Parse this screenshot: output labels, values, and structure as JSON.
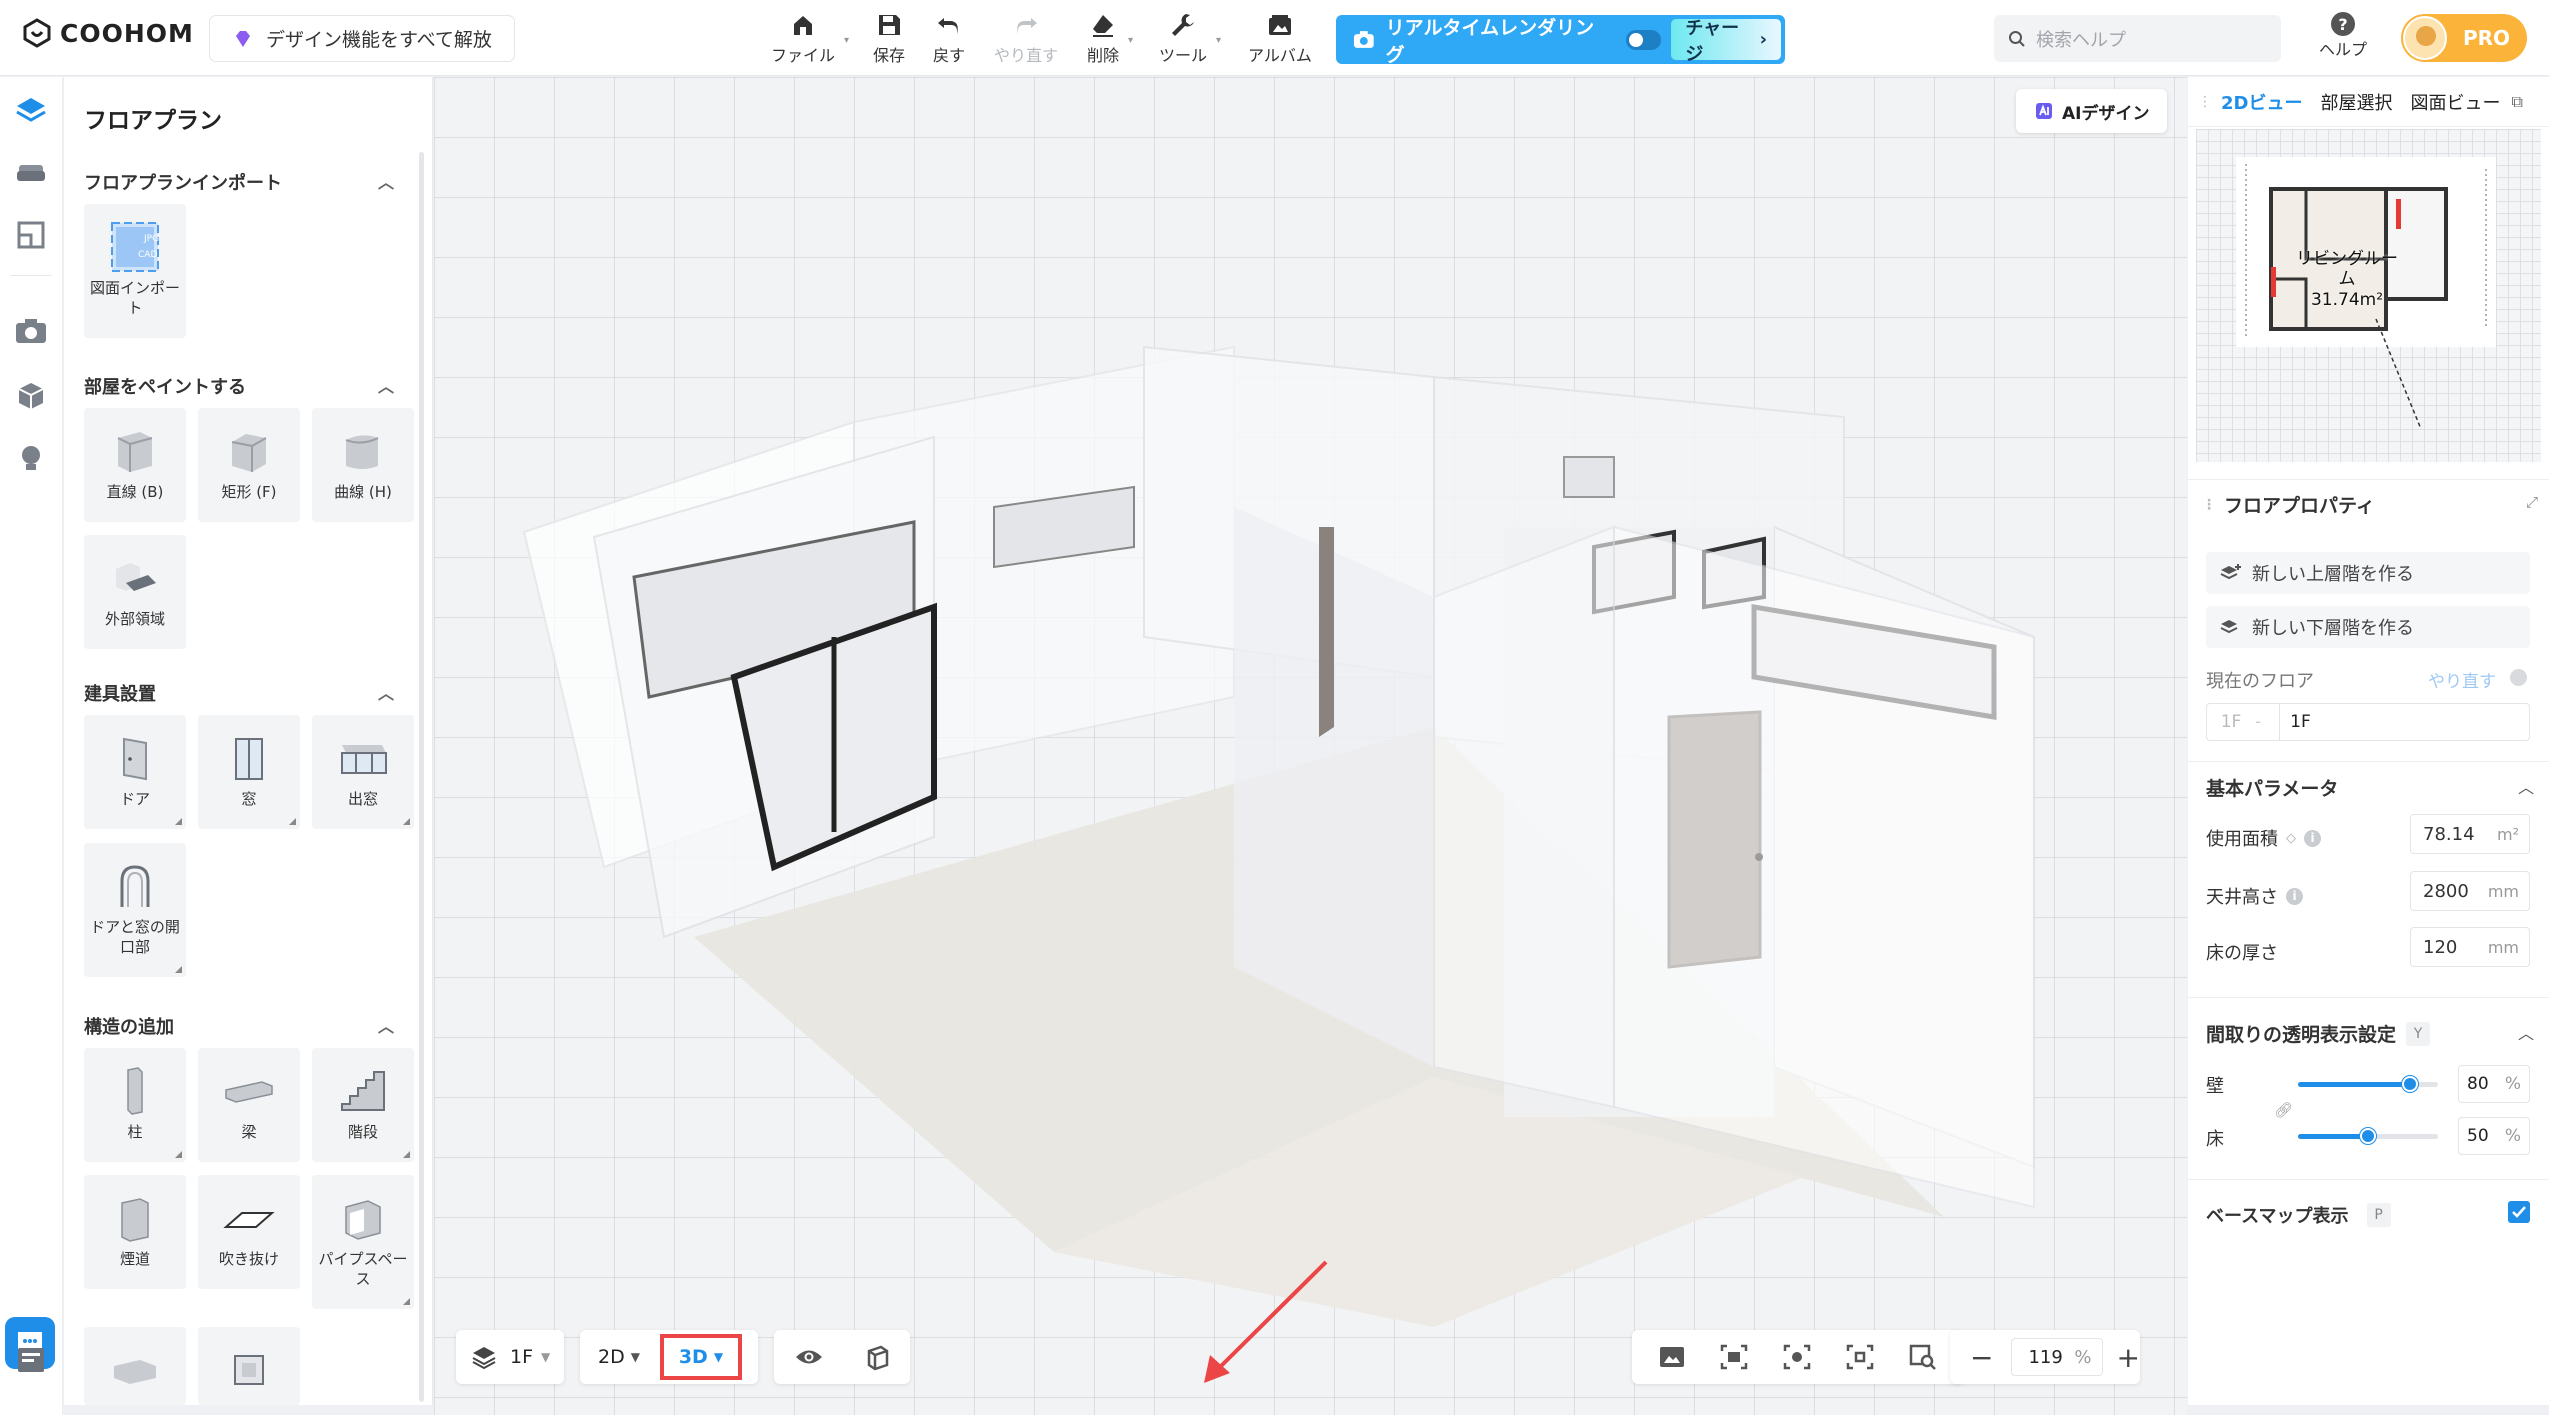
{
  "brand": {
    "name": "COOHOM",
    "unlock_label": "デザイン機能をすべて解放"
  },
  "toolbar": {
    "file": "ファイル",
    "save": "保存",
    "undo": "戻す",
    "redo": "やり直す",
    "delete": "削除",
    "tools": "ツール",
    "album": "アルバム"
  },
  "realtime": {
    "label": "リアルタイムレンダリング",
    "charge_label": "チャージ"
  },
  "search": {
    "placeholder": "検索ヘルプ"
  },
  "help": {
    "label": "ヘルプ"
  },
  "account": {
    "badge": "PRO"
  },
  "left_panel": {
    "title": "フロアプラン",
    "sections": [
      {
        "title": "フロアプランインポート",
        "items": [
          {
            "label": "図面インポート",
            "icon": "import-icon"
          }
        ]
      },
      {
        "title": "部屋をペイントする",
        "items": [
          {
            "label": "直線 (B)",
            "icon": "cube-icon"
          },
          {
            "label": "矩形 (F)",
            "icon": "box-icon"
          },
          {
            "label": "曲線 (H)",
            "icon": "curve-room-icon"
          },
          {
            "label": "外部領域",
            "icon": "exterior-area-icon"
          }
        ]
      },
      {
        "title": "建具設置",
        "items": [
          {
            "label": "ドア",
            "icon": "door-icon"
          },
          {
            "label": "窓",
            "icon": "window-icon"
          },
          {
            "label": "出窓",
            "icon": "bay-window-icon"
          },
          {
            "label": "ドアと窓の開口部",
            "icon": "opening-icon"
          }
        ]
      },
      {
        "title": "構造の追加",
        "items": [
          {
            "label": "柱",
            "icon": "pillar-icon"
          },
          {
            "label": "梁",
            "icon": "beam-icon"
          },
          {
            "label": "階段",
            "icon": "stairs-icon"
          },
          {
            "label": "煙道",
            "icon": "flue-icon"
          },
          {
            "label": "吹き抜け",
            "icon": "void-icon"
          },
          {
            "label": "パイプスペース",
            "icon": "pipe-space-icon"
          }
        ]
      }
    ],
    "import_icon_text": [
      "JPG",
      "CAD"
    ]
  },
  "canvas": {
    "ai_button": "AIデザイン"
  },
  "bottom_bar": {
    "floor": "1F",
    "view_2d": "2D",
    "view_3d": "3D",
    "zoom": "119",
    "zoom_unit": "%"
  },
  "right_panel": {
    "tabs": [
      "2Dビュー",
      "部屋選択",
      "図面ビュー"
    ],
    "minimap": {
      "room_label": "リビングルーム",
      "room_area": "31.74m²"
    },
    "floor_props": {
      "title": "フロアプロパティ",
      "add_upper": "新しい上層階を作る",
      "add_lower": "新しい下層階を作る",
      "current_floor_label": "現在のフロア",
      "redo_link": "やり直す",
      "floor_prefix": "1F",
      "floor_value": "1F"
    },
    "basic_params": {
      "title": "基本パラメータ",
      "rows": [
        {
          "label": "使用面積",
          "value": "78.14",
          "unit": "m²"
        },
        {
          "label": "天井高さ",
          "value": "2800",
          "unit": "mm"
        },
        {
          "label": "床の厚さ",
          "value": "120",
          "unit": "mm"
        }
      ]
    },
    "transparency": {
      "title": "間取りの透明表示設定",
      "shortcut": "Y",
      "wall_label": "壁",
      "wall_value": "80",
      "wall_fraction": 0.8,
      "floor_label": "床",
      "floor_value": "50",
      "floor_fraction": 0.5,
      "unit": "%"
    },
    "basemap": {
      "label": "ベースマップ表示",
      "shortcut": "P",
      "checked": true
    }
  },
  "colors": {
    "accent": "#1f8ee8",
    "realtime": "#2fa8f5",
    "pro": "#fbb33a",
    "highlight": "#e53935"
  }
}
